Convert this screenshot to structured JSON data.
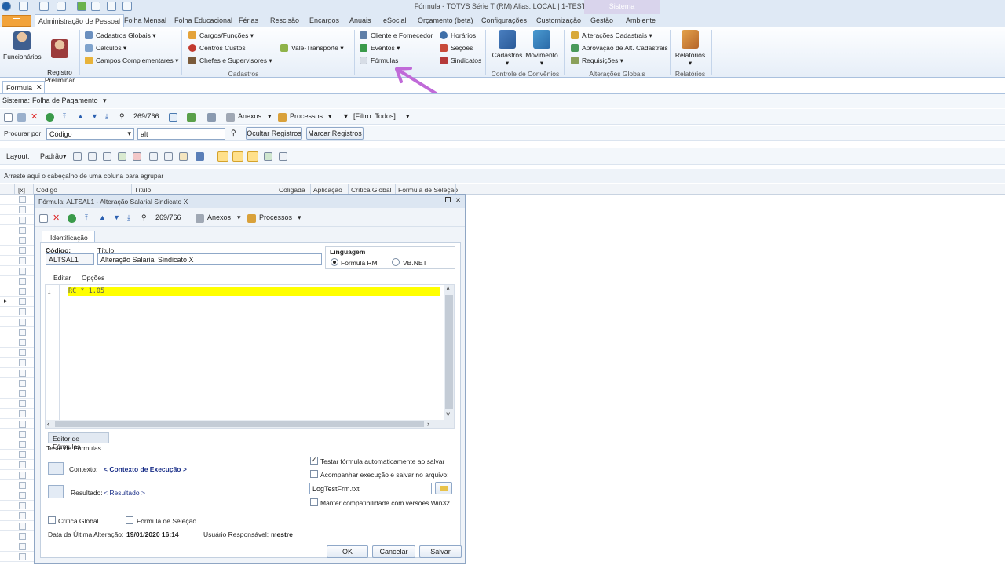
{
  "window_title": "Fórmula - TOTVS Série T  (RM) Alias: LOCAL | 1-TESTE",
  "sistema_label": "Sistema",
  "ribbon_tabs": [
    "Administração de Pessoal",
    "Folha Mensal",
    "Folha Educacional",
    "Férias",
    "Rescisão",
    "Encargos",
    "Anuais",
    "eSocial",
    "Orçamento (beta)",
    "Configurações",
    "Customização",
    "Gestão",
    "Ambiente"
  ],
  "ribbon": {
    "funcionarios": "Funcionários",
    "registro_preliminar": "Registro\nPreliminar",
    "cadastros_globais": "Cadastros Globais",
    "calculos": "Cálculos",
    "campos_complementares": "Campos Complementares",
    "cargos_funcoes": "Cargos/Funções",
    "centros_custos": "Centros Custos",
    "chefes_supervisores": "Chefes e Supervisores",
    "vale_transporte": "Vale-Transporte",
    "cliente_fornecedor": "Cliente e Fornecedor",
    "eventos": "Eventos",
    "formulas": "Fórmulas",
    "horarios": "Horários",
    "secoes": "Seções",
    "sindicatos": "Sindicatos",
    "cadastros_big": "Cadastros",
    "movimento_big": "Movimento",
    "alteracoes_cadastrais": "Alterações Cadastrais",
    "aprovacao_alt": "Aprovação de Alt. Cadastrais",
    "requisicoes": "Requisições",
    "relatorios_big": "Relatórios",
    "group_cadastros": "Cadastros",
    "group_convenios": "Controle de Convênios",
    "group_alteracoes": "Alterações Globais",
    "group_relatorios": "Relatórios"
  },
  "doc_tab": "Fórmula",
  "sistema_row": {
    "label": "Sistema:",
    "value": "Folha de Pagamento"
  },
  "toolbar": {
    "counter": "269/766",
    "anexos": "Anexos",
    "processos": "Processos",
    "filtro": "[Filtro: Todos]"
  },
  "search": {
    "label": "Procurar por:",
    "field": "Código",
    "value": "alt",
    "ocultar": "Ocultar Registros",
    "marcar": "Marcar Registros"
  },
  "layout": {
    "label": "Layout:",
    "value": "Padrão"
  },
  "group_hint": "Arraste aqui o cabeçalho de uma coluna para agrupar",
  "grid_columns": [
    "[x]",
    "Código",
    "Título",
    "Coligada",
    "Aplicação",
    "Crítica Global",
    "Fórmula de Seleção"
  ],
  "dialog": {
    "title": "Fórmula: ALTSAL1 - Alteração Salarial Sindicato X",
    "counter": "269/766",
    "anexos": "Anexos",
    "processos": "Processos",
    "tab_identificacao": "Identificação",
    "codigo_label": "Código:",
    "codigo_value": "ALTSAL1",
    "titulo_label": "Título",
    "titulo_value": "Alteração Salarial Sindicato X",
    "linguagem_label": "Linguagem",
    "lang_rm": "Fórmula RM",
    "lang_vb": "VB.NET",
    "menu_editar": "Editar",
    "menu_opcoes": "Opções",
    "line_number": "1",
    "code": "RC * 1.05",
    "editor_tab": "Editor de Fórmulas",
    "teste_label": "Teste de Fórmulas",
    "contexto_label": "Contexto:",
    "contexto_value": "< Contexto de Execução >",
    "resultado_label": "Resultado:",
    "resultado_value": "< Resultado >",
    "chk_testar": "Testar fórmula automaticamente ao salvar",
    "chk_acompanhar": "Acompanhar execução e salvar no arquivo:",
    "log_file": "LogTestFrm.txt",
    "chk_manter": "Manter compatibilidade com versões Win32",
    "critica_global": "Crítica Global",
    "formula_selecao": "Fórmula de Seleção",
    "data_label": "Data da Última Alteração:",
    "data_value": "19/01/2020 16:14",
    "usuario_label": "Usuário Responsável:",
    "usuario_value": "mestre",
    "ok": "OK",
    "cancelar": "Cancelar",
    "salvar": "Salvar"
  }
}
